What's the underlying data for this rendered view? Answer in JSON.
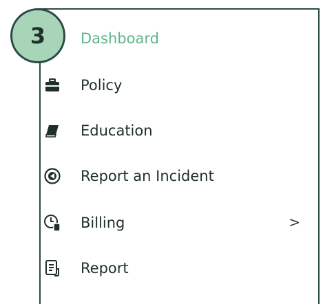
{
  "step_badge": {
    "label": "3"
  },
  "nav": {
    "items": [
      {
        "label": "Dashboard",
        "icon": "dashboard-icon",
        "active": true
      },
      {
        "label": "Policy",
        "icon": "briefcase-icon",
        "active": false
      },
      {
        "label": "Education",
        "icon": "book-icon",
        "active": false
      },
      {
        "label": "Report an Incident",
        "icon": "incident-icon",
        "active": false
      },
      {
        "label": "Billing",
        "icon": "billing-clock-icon",
        "active": false,
        "chevron": ">"
      },
      {
        "label": "Report",
        "icon": "document-icon",
        "active": false
      }
    ]
  },
  "colors": {
    "accent": "#5fb388",
    "badge": "#a8d5b7",
    "border": "#2a4a45",
    "text": "#1f2f2c"
  }
}
